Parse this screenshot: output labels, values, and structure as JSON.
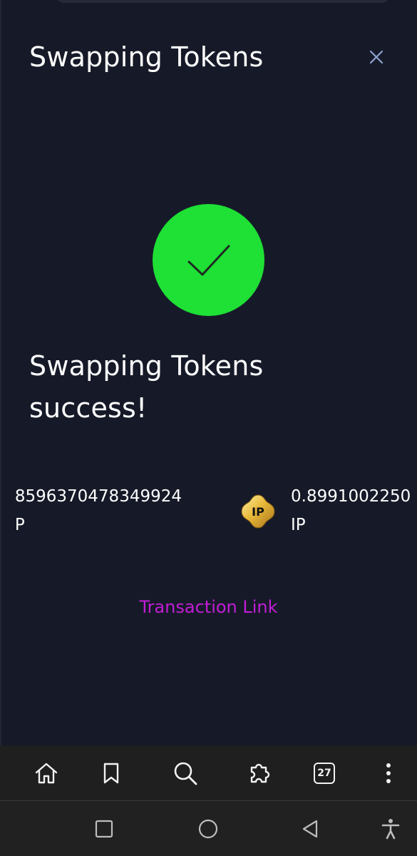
{
  "modal": {
    "title": "Swapping Tokens",
    "close_icon": "close-icon"
  },
  "status": {
    "icon": "checkmark-icon",
    "color": "#1ee035",
    "message": "Swapping Tokens success!"
  },
  "swap": {
    "from_amount": "8596370478349924",
    "from_unit": "P",
    "token_icon_label": "IP",
    "to_amount": "0.8991002250",
    "to_unit": "IP"
  },
  "transaction_link": {
    "label": "Transaction Link",
    "color": "#c21dd6"
  },
  "browser_nav": {
    "tab_count": "27",
    "icons": [
      "home-icon",
      "bookmark-icon",
      "search-icon",
      "extensions-icon",
      "tabs-icon",
      "more-vertical-icon"
    ]
  },
  "system_nav": {
    "icons": [
      "recent-apps-icon",
      "home-circle-icon",
      "back-icon",
      "accessibility-icon"
    ]
  }
}
